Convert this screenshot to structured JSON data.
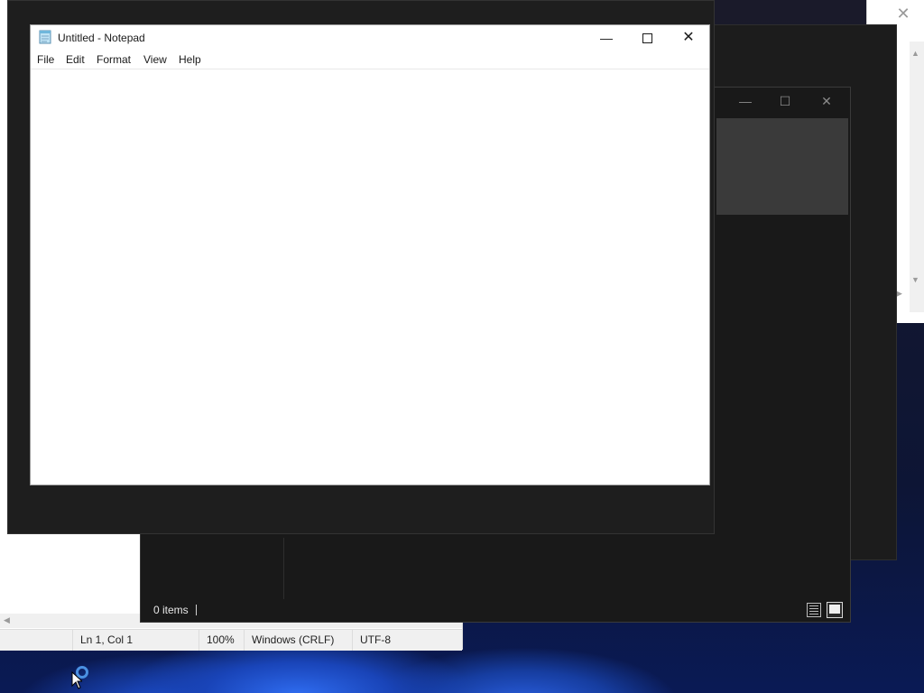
{
  "background_windows": {
    "white_window": {
      "close_glyph": "✕"
    },
    "explorer": {
      "controls": {
        "minimize": "—",
        "maximize": "☐",
        "close": "✕"
      },
      "status_items": "0 items"
    },
    "old_notepad": {
      "status": {
        "position": "Ln 1, Col 1",
        "zoom": "100%",
        "line_ending": "Windows (CRLF)",
        "encoding": "UTF-8"
      }
    }
  },
  "notepad": {
    "title": "Untitled - Notepad",
    "controls": {
      "minimize": "—",
      "close": "✕"
    },
    "menu": {
      "file": "File",
      "edit": "Edit",
      "format": "Format",
      "view": "View",
      "help": "Help"
    },
    "content": ""
  },
  "icons": [
    "notepad-icon",
    "minimize-icon",
    "maximize-icon",
    "close-icon",
    "details-view-icon",
    "tiles-view-icon",
    "cortana-icon",
    "mouse-cursor-icon"
  ]
}
